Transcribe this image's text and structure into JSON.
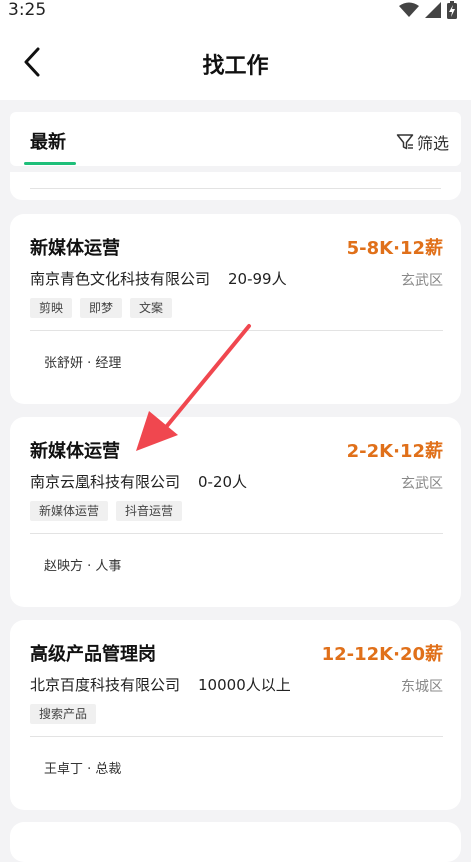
{
  "status_bar": {
    "time": "3:25"
  },
  "header": {
    "title": "找工作"
  },
  "tabs": {
    "latest": "最新",
    "filter": "筛选"
  },
  "jobs": [
    {
      "title": "新媒体运营",
      "salary": "5-8K·12薪",
      "company": "南京青色文化科技有限公司",
      "size": "20-99人",
      "district": "玄武区",
      "tags": [
        "剪映",
        "即梦",
        "文案"
      ],
      "recruiter": "张舒妍 · 经理"
    },
    {
      "title": "新媒体运营",
      "salary": "2-2K·12薪",
      "company": "南京云凰科技有限公司",
      "size": "0-20人",
      "district": "玄武区",
      "tags": [
        "新媒体运营",
        "抖音运营"
      ],
      "recruiter": "赵映方 · 人事"
    },
    {
      "title": "高级产品管理岗",
      "salary": "12-12K·20薪",
      "company": "北京百度科技有限公司",
      "size": "10000人以上",
      "district": "东城区",
      "tags": [
        "搜索产品"
      ],
      "recruiter": "王卓丁 · 总裁"
    }
  ],
  "colors": {
    "accent": "#1fbf7a",
    "salary": "#e0701a",
    "arrow": "#f0474f"
  },
  "icons": [
    "wifi-icon",
    "signal-icon",
    "battery-icon",
    "back-arrow-icon",
    "filter-icon"
  ]
}
